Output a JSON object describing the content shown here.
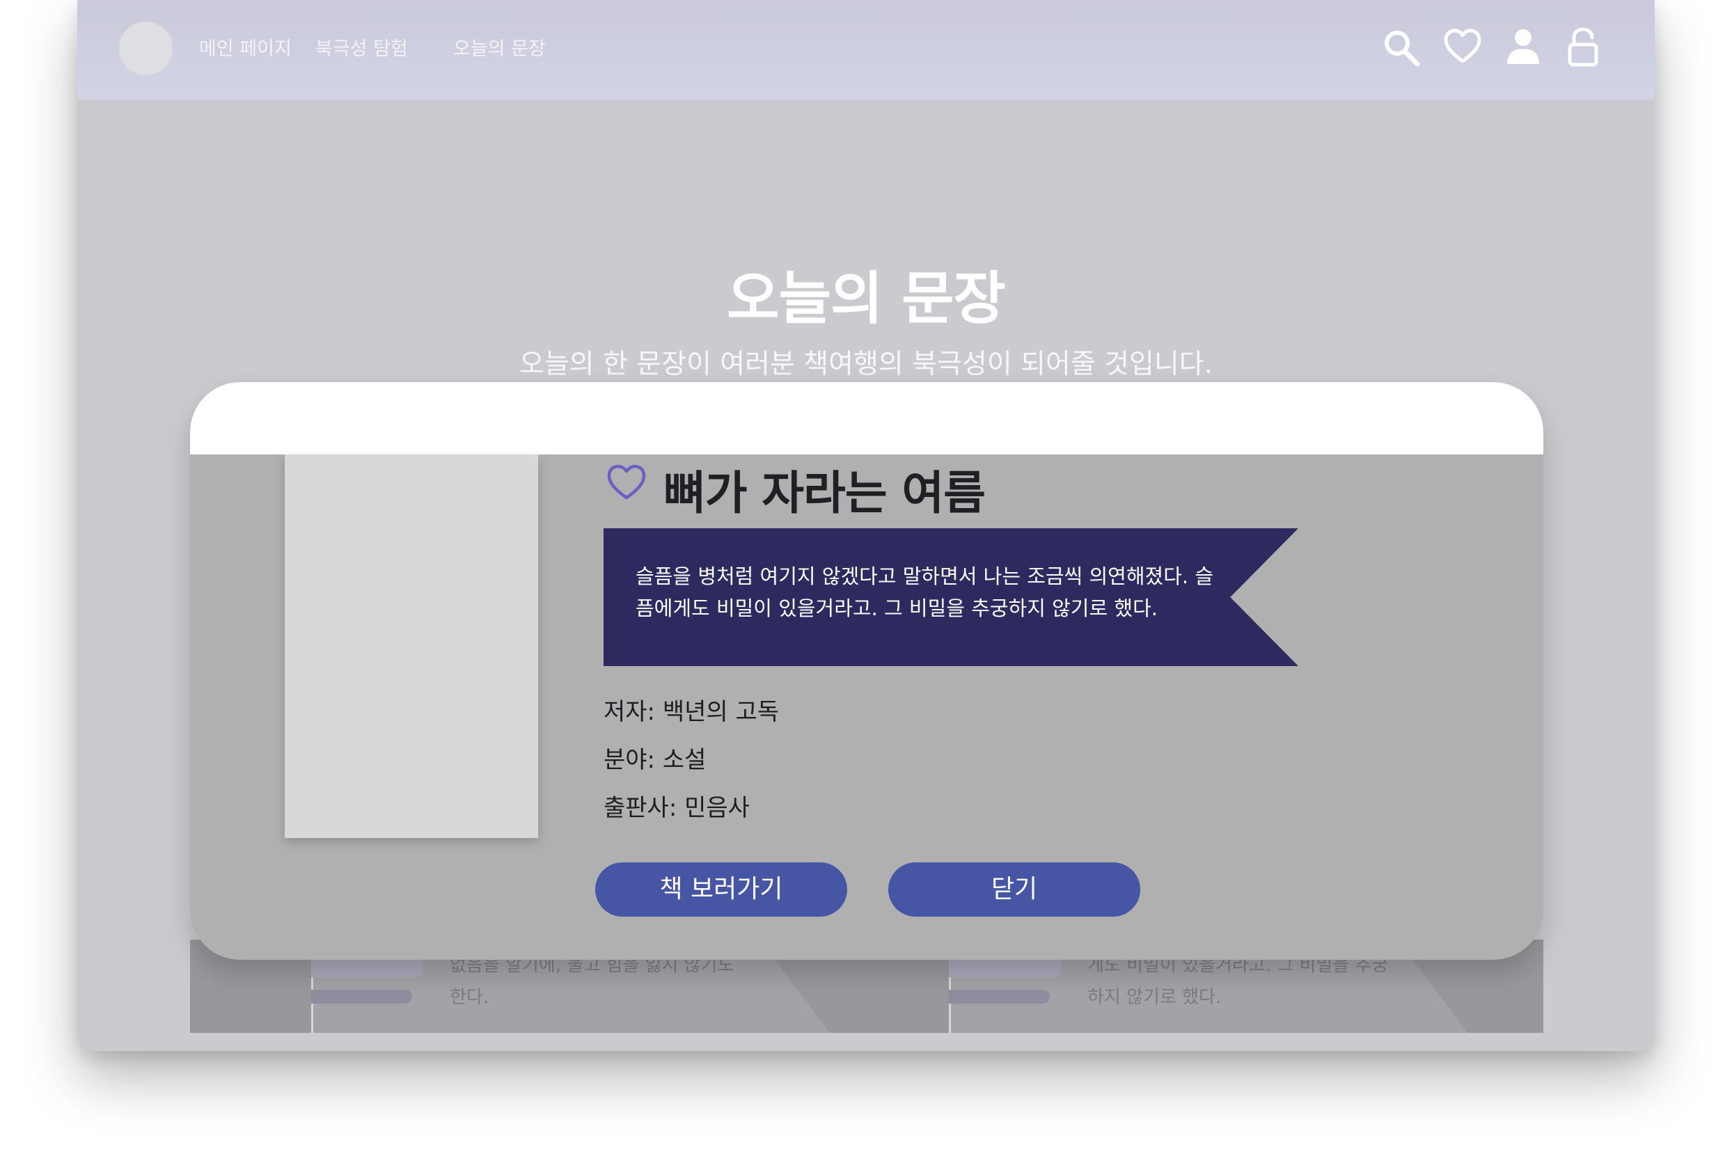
{
  "nav": {
    "links": [
      "메인 페이지",
      "북극성 탐험",
      "오늘의 문장"
    ],
    "icons": [
      "search-icon",
      "heart-icon",
      "user-icon",
      "unlock-icon"
    ]
  },
  "hero": {
    "title": "오늘의 문장",
    "subtitle": "오늘의 한 문장이 여러분 책여행의 북극성이 되어줄 것입니다."
  },
  "background_cards": [
    {
      "text": "없음을 알기에, 울고 힘을 잃지 않기도 한다."
    },
    {
      "text": "게도 비밀이 있을거라고. 그 비밀을 추궁하지 않기로 했다."
    }
  ],
  "modal": {
    "title": "뼈가 자라는 여름",
    "quote": "슬픔을 병처럼 여기지 않겠다고 말하면서 나는 조금씩 의연해졌다. 슬픔에게도 비밀이 있을거라고. 그 비밀을 추궁하지 않기로 했다.",
    "author": "저자: 백년의 고독",
    "genre": "분야: 소설",
    "publisher": "출판사: 민음사",
    "view_button": "책 보러가기",
    "close_button": "닫기"
  },
  "colors": {
    "ribbon": "#2d2a5f",
    "button": "#4656a4",
    "heart_outline": "#6b5fc2"
  }
}
